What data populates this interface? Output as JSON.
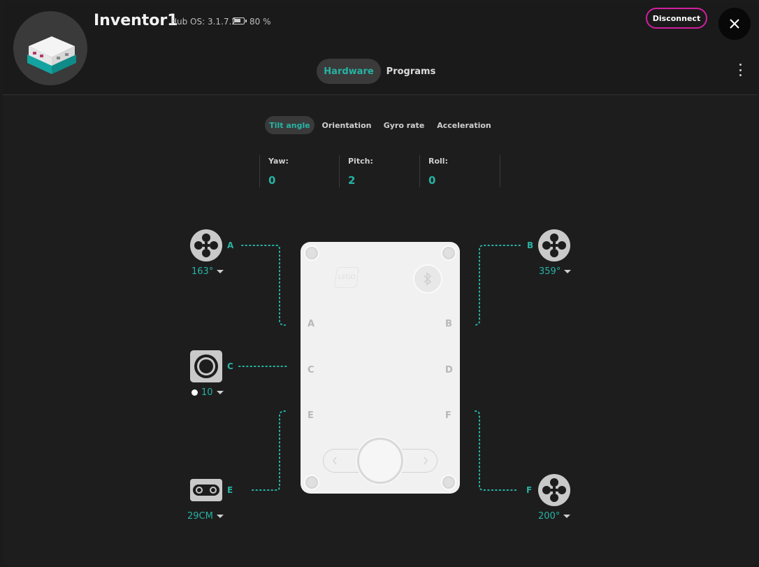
{
  "header": {
    "hub_name": "Inventor1",
    "hub_os": "Hub OS: 3.1.7.2",
    "battery": "80 %",
    "disconnect_label": "Disconnect"
  },
  "tabs": [
    {
      "label": "Hardware",
      "active": true
    },
    {
      "label": "Programs",
      "active": false
    }
  ],
  "sensor_tabs": [
    {
      "label": "Tilt angle",
      "active": true
    },
    {
      "label": "Orientation",
      "active": false
    },
    {
      "label": "Gyro rate",
      "active": false
    },
    {
      "label": "Acceleration",
      "active": false
    }
  ],
  "readouts": [
    {
      "label": "Yaw:",
      "value": "0"
    },
    {
      "label": "Pitch:",
      "value": "2"
    },
    {
      "label": "Roll:",
      "value": "0"
    }
  ],
  "ports": {
    "A": {
      "letter": "A",
      "device": "motor-icon",
      "value": "163°"
    },
    "B": {
      "letter": "B",
      "device": "motor-icon",
      "value": "359°"
    },
    "C": {
      "letter": "C",
      "device": "color-sensor-icon",
      "value": "10"
    },
    "E": {
      "letter": "E",
      "device": "distance-sensor-icon",
      "value": "29CM"
    },
    "F": {
      "letter": "F",
      "device": "motor-icon",
      "value": "200°"
    }
  },
  "hub_labels": [
    "A",
    "B",
    "C",
    "D",
    "E",
    "F"
  ],
  "colors": {
    "accent": "#27b3a4",
    "disconnect_border": "#d01fa0",
    "background": "#1d1d1d"
  }
}
